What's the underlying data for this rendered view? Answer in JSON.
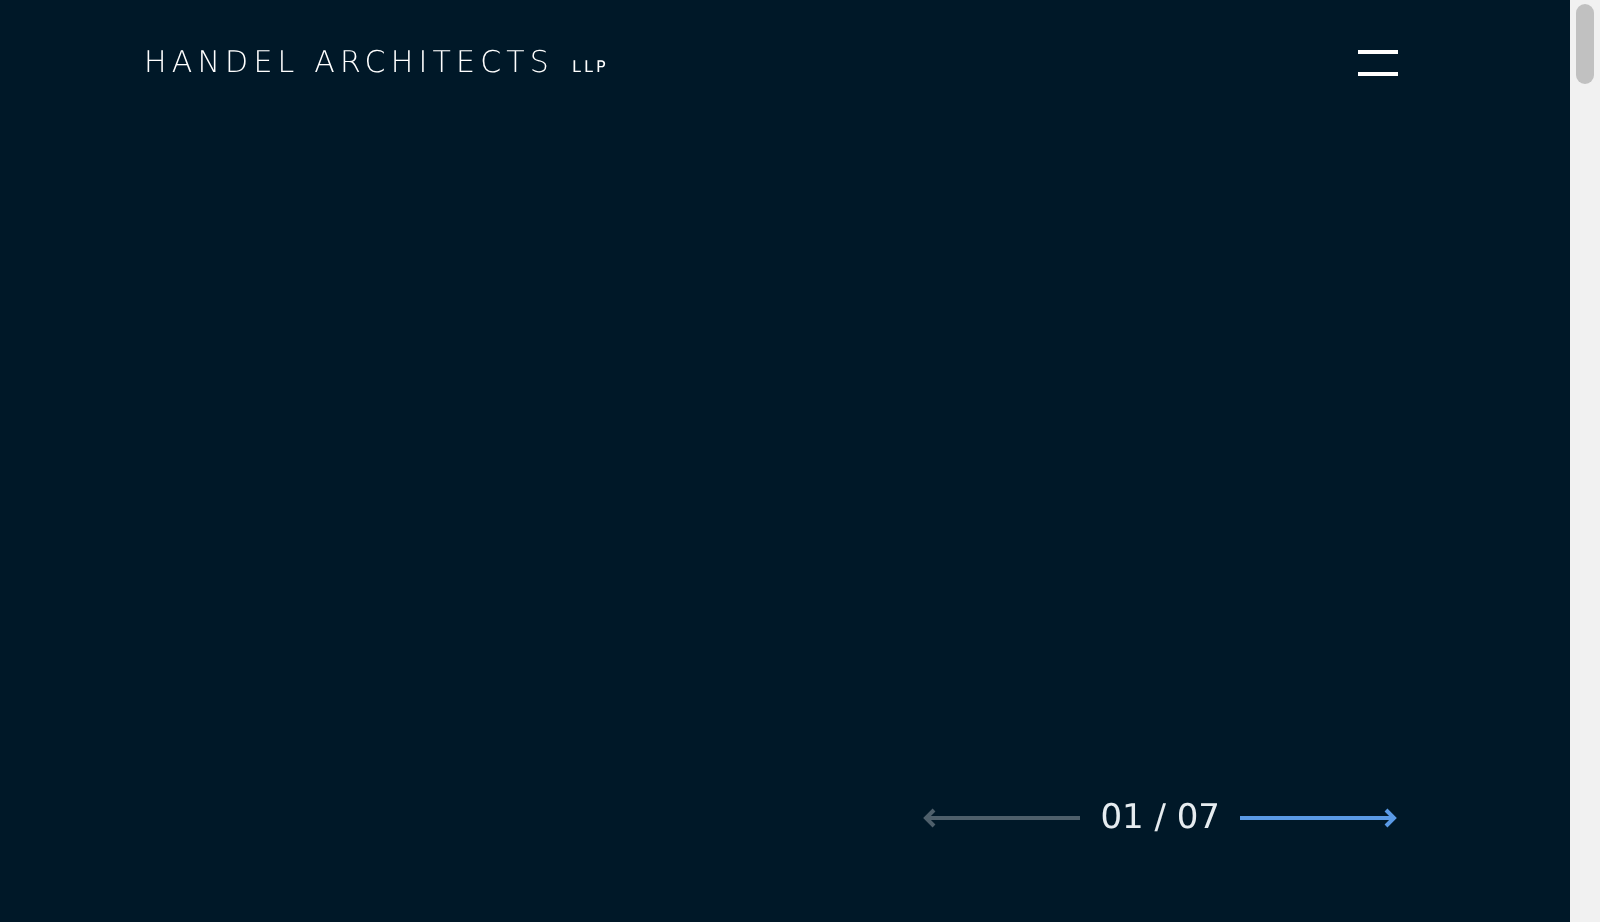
{
  "header": {
    "logo": "HANDEL ARCHITECTS",
    "logo_suffix": "LLP"
  },
  "slider": {
    "counter": "01 / 07",
    "prev": {
      "disabled": true
    },
    "next": {
      "disabled": false
    }
  }
}
